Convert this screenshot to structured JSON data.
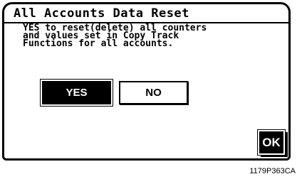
{
  "dialog": {
    "title": "All Accounts Data Reset",
    "message_lines": [
      "YES to reset(delete) all counters",
      "and values set in Copy Track",
      "Functions for all accounts."
    ],
    "yes_label": "YES",
    "no_label": "NO",
    "ok_label": "OK"
  },
  "caption": "1179P363CA"
}
